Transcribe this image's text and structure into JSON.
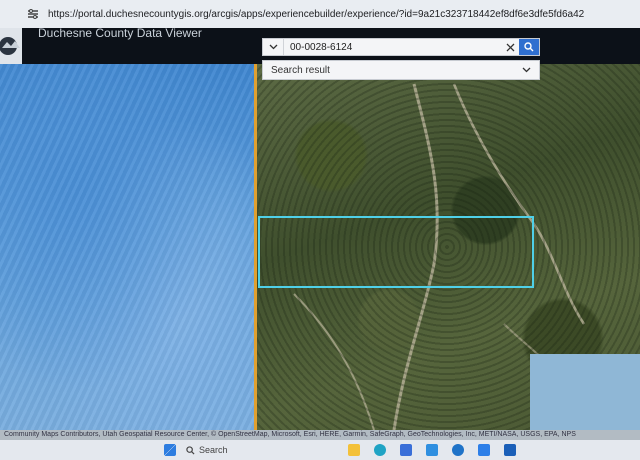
{
  "browser": {
    "url": "https://portal.duchesnecountygis.org/arcgis/apps/experiencebuilder/experience/?id=9a21c323718442ef8df6e3dfe5fd6a42"
  },
  "app": {
    "title": "Duchesne County Data Viewer"
  },
  "search": {
    "value": "00-0028-6124",
    "result_label": "Search result"
  },
  "attribution": "Community Maps Contributors, Utah Geospatial Resource Center, © OpenStreetMap, Microsoft, Esri, HERE, Garmin, SafeGraph, GeoTechnologies, Inc, METI/NASA, USGS, EPA, NPS",
  "taskbar": {
    "search_placeholder": "Search",
    "icon_names": [
      "windows-start-icon",
      "file-explorer-icon",
      "edge-browser-icon",
      "store-icon",
      "mail-icon",
      "hp-icon",
      "dropbox-icon",
      "outlook-icon"
    ]
  },
  "colors": {
    "parcel_outline": "#4fd0e8",
    "county_boundary": "#e0a030",
    "search_button": "#2f6fcf"
  }
}
